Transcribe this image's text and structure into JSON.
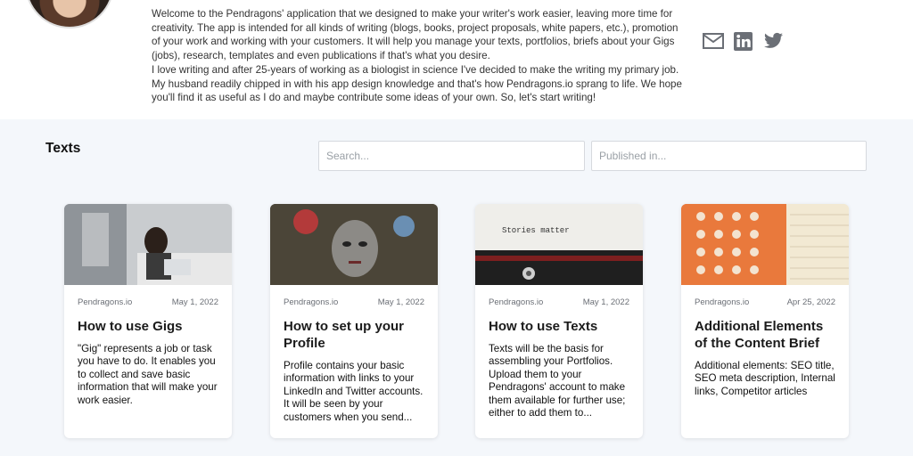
{
  "profile": {
    "bio_lines": [
      "Welcome to the Pendragons' application that we designed to make your writer's work easier, leaving more time for",
      "creativity. The app is intended for all kinds of writing (blogs, books, project proposals, white papers, etc.), promotion",
      "of your work and working with your customers. It will help you manage your texts, portfolios, briefs about your Gigs",
      "(jobs), research, templates and even publications if that's what you desire.",
      "I love writing and after 25-years of working as a biologist in science I've decided to make the writing my primary job.",
      "My husband readily chipped in with his app design knowledge and that's how Pendragons.io sprang to life. We hope",
      "you'll find it as useful as I do and maybe contribute some ideas of your own. So, let's start writing!"
    ]
  },
  "social": {
    "mail_icon": "mail-icon",
    "linkedin_icon": "linkedin-icon",
    "twitter_icon": "twitter-icon"
  },
  "section": {
    "title": "Texts"
  },
  "filters": {
    "search_placeholder": "Search...",
    "published_placeholder": "Published in..."
  },
  "cards": [
    {
      "source": "Pendragons.io",
      "date": "May 1, 2022",
      "title": "How to use Gigs",
      "excerpt": "\"Gig\" represents a job or task you have to do. It enables you to collect and save basic information that will make your work easier."
    },
    {
      "source": "Pendragons.io",
      "date": "May 1, 2022",
      "title": "How to set up your Profile",
      "excerpt": "Profile contains your basic information with links to your LinkedIn and Twitter accounts. It will be seen by your customers when you send..."
    },
    {
      "source": "Pendragons.io",
      "date": "May 1, 2022",
      "title": "How to use Texts",
      "excerpt": "Texts will be the basis for assembling your Portfolios. Upload them to your Pendragons' account to make them available for further use; either to add them to...",
      "image_text": "Stories matter"
    },
    {
      "source": "Pendragons.io",
      "date": "Apr 25, 2022",
      "title": "Additional Elements of the Content Brief",
      "excerpt": "Additional elements: SEO title, SEO meta description, Internal links, Competitor articles"
    }
  ],
  "colors": {
    "page_background": "#f4f7fb",
    "card_background": "#ffffff",
    "icon_gray": "#6b6f76"
  }
}
